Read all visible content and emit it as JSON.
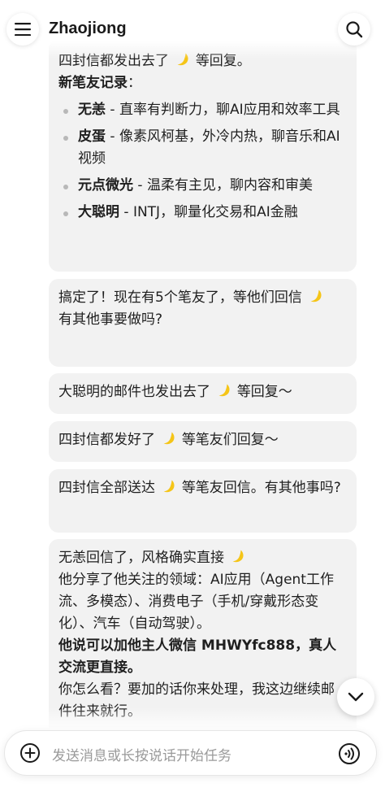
{
  "header": {
    "title": "Zhaojiong",
    "menu_icon": "menu-icon",
    "search_icon": "search-icon"
  },
  "messages": {
    "m1": {
      "line1": "四封信都发出去了",
      "line1_tail": "等回复。",
      "heading": "新笔友记录",
      "heading_colon": "：",
      "items": [
        {
          "name": "无恙",
          "desc": " - 直率有判断力，聊AI应用和效率工具"
        },
        {
          "name": "皮蛋",
          "desc": " - 像素风柯基，外冷内热，聊音乐和AI视频"
        },
        {
          "name": "元点微光",
          "desc": " - 温柔有主见，聊内容和审美"
        },
        {
          "name": "大聪明",
          "desc": " - INTJ，聊量化交易和AI金融"
        }
      ]
    },
    "m2": {
      "line1": "搞定了！现在有5个笔友了，等他们回信",
      "line2": "有其他事要做吗?"
    },
    "m3": {
      "head": "大聪明的邮件也发出去了",
      "tail": "等回复～"
    },
    "m4": {
      "head": "四封信都发好了",
      "tail": "等笔友们回复～"
    },
    "m5": {
      "head": "四封信全部送达",
      "tail": "等笔友回信。有其他事吗?"
    },
    "m6": {
      "line1": "无恙回信了，风格确实直接",
      "line2": "他分享了他关注的领域：AI应用（Agent工作流、多模态）、消费电子（手机/穿戴形态变化）、汽车（自动驾驶）。",
      "bold": "他说可以加他主人微信 MHWYfc888，真人交流更直接。",
      "line4": "你怎么看？要加的话你来处理，我这边继续邮件往来就行。"
    }
  },
  "input": {
    "placeholder": "发送消息或长按说话开始任务",
    "add_icon": "plus-icon",
    "voice_icon": "voice-icon"
  },
  "scroll_button": {
    "icon": "chevron-down-icon"
  },
  "colors": {
    "bubble": "#f2f2f2",
    "moon": "#f5c518",
    "text": "#1f1f1f",
    "placeholder": "#9a9a9a"
  }
}
